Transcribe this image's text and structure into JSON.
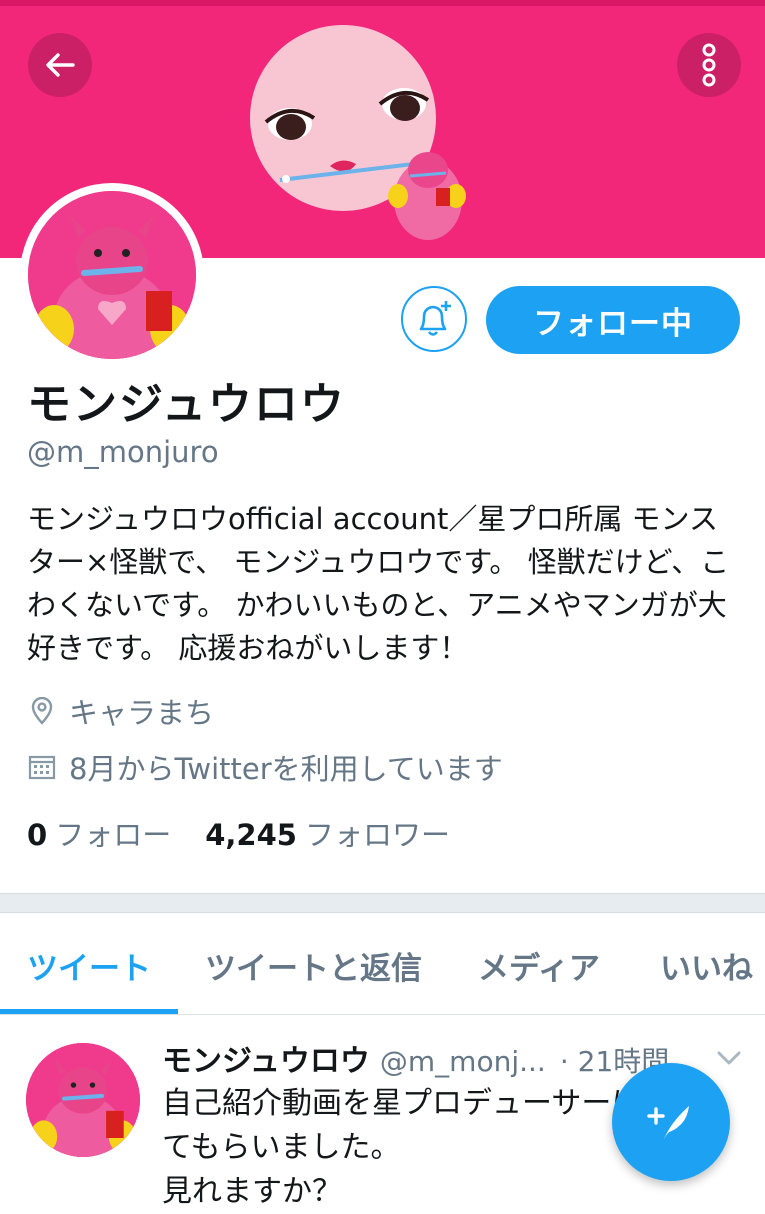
{
  "header": {
    "back_icon": "arrow-left-icon",
    "more_icon": "more-vertical-icon",
    "banner_color": "#f2277a"
  },
  "profile": {
    "name": "モンジュウロウ",
    "handle": "@m_monjuro",
    "bio": "モンジュウロウofficial account／星プロ所属 モンスター×怪獣で、 モンジュウロウです。 怪獣だけど、こわくないです。 かわいいものと、アニメやマンガが大好きです。 応援おねがいします！",
    "location": "キャラまち",
    "joined": "8月からTwitterを利用しています",
    "following_count": "0",
    "following_label": "フォロー",
    "followers_count": "4,245",
    "followers_label": "フォロワー"
  },
  "actions": {
    "notify_icon": "bell-plus-icon",
    "follow_label": "フォロー中",
    "accent_color": "#1da1f2"
  },
  "tabs": [
    {
      "label": "ツイート",
      "active": true
    },
    {
      "label": "ツイートと返信",
      "active": false
    },
    {
      "label": "メディア",
      "active": false
    },
    {
      "label": "いいね",
      "active": false
    }
  ],
  "tweet": {
    "name": "モンジュウロウ",
    "handle": "@m_monj...",
    "time": "· 21時間",
    "lines": [
      "自己紹介動画を星プロデューサーに作っ",
      "てもらいました。",
      "見れますか？"
    ]
  },
  "compose": {
    "icon": "compose-tweet-icon"
  }
}
